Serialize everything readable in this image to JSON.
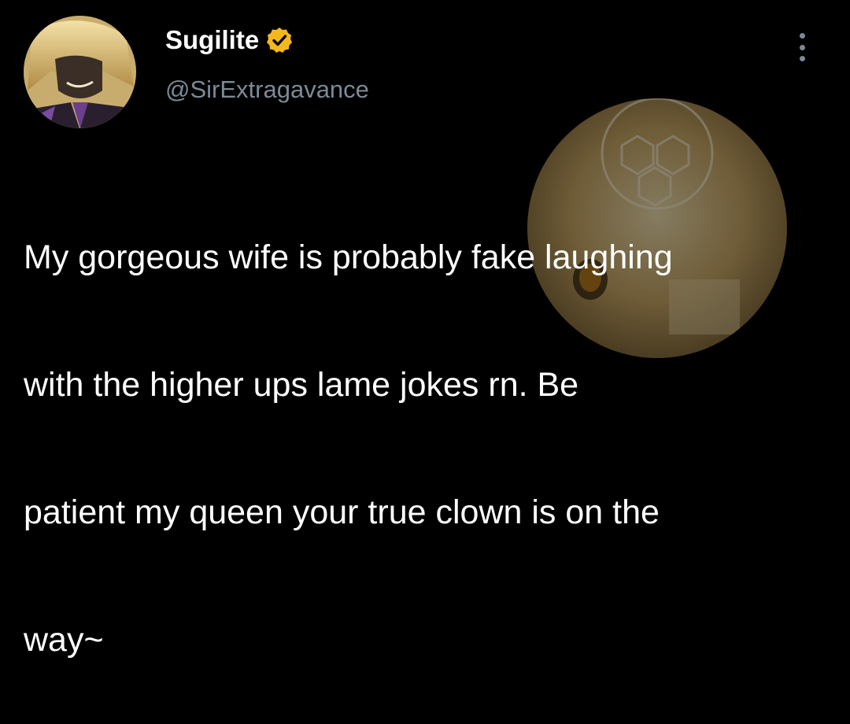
{
  "user": {
    "display_name": "Sugilite",
    "handle": "@SirExtragavance",
    "verified": true,
    "badge_color": "#f5b81c"
  },
  "icons": {
    "verified": "verified-badge-icon",
    "more": "more-vertical-icon"
  },
  "tweet": {
    "lines": [
      "My gorgeous wife is probably fake laughing",
      "with the higher ups lame jokes rn. Be",
      "patient my queen your true clown is on the",
      "way~"
    ]
  },
  "colors": {
    "background": "#000000",
    "text": "#ffffff",
    "secondary": "#7b8a97"
  }
}
